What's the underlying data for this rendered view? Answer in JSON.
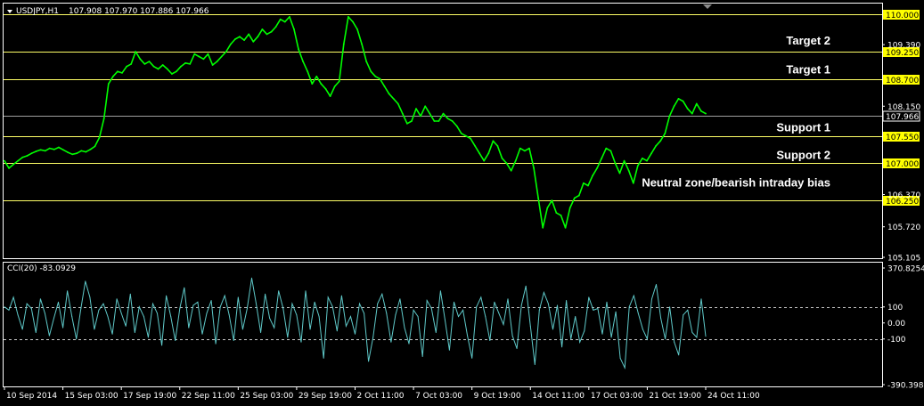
{
  "header": {
    "symbol": "USDJPY,H1",
    "quotes": "107.908 107.970 107.886 107.966",
    "indicator": "CCI(20) -83.0929"
  },
  "colors": {
    "background": "#000000",
    "frame": "#ffffff",
    "price": "#00ff00",
    "level_line": "#ffff66",
    "level_box": "#ffff00",
    "cci": "#5fc9c9"
  },
  "chart_data": [
    {
      "type": "line",
      "series": [
        {
          "values": [
            107.05,
            106.9,
            106.98,
            107.05,
            107.12,
            107.15,
            107.2,
            107.24,
            107.27,
            107.25,
            107.3,
            107.28,
            107.32,
            107.27,
            107.22,
            107.18,
            107.2,
            107.25,
            107.23,
            107.28,
            107.34,
            107.52,
            107.9,
            108.6,
            108.75,
            108.85,
            108.82,
            108.95,
            109.0,
            109.25,
            109.1,
            109.0,
            109.05,
            108.95,
            108.9,
            108.98,
            108.9,
            108.8,
            108.85,
            108.95,
            109.02,
            109.0,
            109.2,
            109.15,
            109.1,
            109.2,
            108.98,
            109.05,
            109.15,
            109.25,
            109.4,
            109.5,
            109.55,
            109.48,
            109.6,
            109.45,
            109.55,
            109.7,
            109.6,
            109.65,
            109.75,
            109.9,
            109.85,
            109.95,
            109.7,
            109.3,
            109.05,
            108.85,
            108.6,
            108.75,
            108.6,
            108.5,
            108.35,
            108.55,
            108.65,
            109.4,
            109.95,
            109.85,
            109.7,
            109.4,
            109.05,
            108.85,
            108.75,
            108.7,
            108.55,
            108.4,
            108.3,
            108.2,
            108.0,
            107.8,
            107.85,
            108.1,
            107.95,
            108.15,
            108.0,
            107.85,
            107.85,
            108.0,
            107.9,
            107.85,
            107.75,
            107.6,
            107.55,
            107.5,
            107.35,
            107.2,
            107.05,
            107.2,
            107.45,
            107.35,
            107.1,
            107.0,
            106.85,
            107.05,
            107.3,
            107.25,
            107.3,
            106.9,
            106.3,
            105.7,
            106.1,
            106.25,
            106.0,
            105.95,
            105.7,
            106.1,
            106.3,
            106.35,
            106.6,
            106.55,
            106.75,
            106.9,
            107.1,
            107.3,
            107.25,
            107.0,
            106.8,
            107.05,
            106.85,
            106.6,
            106.95,
            107.1,
            107.05,
            107.2,
            107.35,
            107.45,
            107.6,
            107.95,
            108.15,
            108.3,
            108.25,
            108.1,
            108.0,
            108.2,
            108.05,
            108.0
          ]
        }
      ],
      "y_ticks": [
        "110.000",
        "109.390",
        "109.250",
        "108.700",
        "108.150",
        "107.966",
        "107.550",
        "107.000",
        "106.370",
        "106.250",
        "105.720",
        "105.105"
      ],
      "x_ticks": [
        "10 Sep 2014",
        "15 Sep 03:00",
        "17 Sep 19:00",
        "22 Sep 11:00",
        "25 Sep 03:00",
        "29 Sep 19:00",
        "2 Oct 11:00",
        "7 Oct 03:00",
        "9 Oct 19:00",
        "14 Oct 11:00",
        "17 Oct 03:00",
        "21 Oct 19:00",
        "24 Oct 11:00"
      ],
      "levels": [
        {
          "price": 110.0,
          "label": "110.000"
        },
        {
          "price": 109.25,
          "label": "109.250"
        },
        {
          "price": 108.7,
          "label": "108.700"
        },
        {
          "price": 107.55,
          "label": "107.550"
        },
        {
          "price": 107.0,
          "label": "107.000"
        },
        {
          "price": 106.25,
          "label": "106.250"
        }
      ],
      "current": {
        "price": 107.966,
        "label": "107.966"
      },
      "ylim": [
        105.105,
        110.2
      ],
      "annotations": [
        {
          "text": "Target 2",
          "price": 109.48
        },
        {
          "text": "Target 1",
          "price": 108.9
        },
        {
          "text": "Support 1",
          "price": 107.73
        },
        {
          "text": "Support 2",
          "price": 107.18
        },
        {
          "text": "Neutral zone/bearish intraday bias",
          "price": 106.62
        }
      ]
    },
    {
      "type": "line",
      "series": [
        {
          "values": [
            100,
            80,
            160,
            50,
            -40,
            120,
            90,
            -60,
            150,
            60,
            -80,
            30,
            130,
            -30,
            200,
            40,
            -100,
            90,
            260,
            160,
            -40,
            80,
            120,
            40,
            -70,
            150,
            60,
            -20,
            180,
            -60,
            100,
            40,
            -90,
            120,
            60,
            -140,
            170,
            40,
            -110,
            90,
            220,
            -30,
            110,
            130,
            -70,
            60,
            140,
            -130,
            100,
            170,
            50,
            -110,
            160,
            -40,
            90,
            280,
            120,
            -60,
            180,
            30,
            -30,
            200,
            90,
            -90,
            120,
            50,
            -120,
            200,
            -40,
            130,
            40,
            -220,
            160,
            100,
            -50,
            170,
            -20,
            40,
            -70,
            120,
            60,
            -240,
            -90,
            120,
            180,
            60,
            -120,
            50,
            150,
            -30,
            -130,
            80,
            40,
            -210,
            140,
            90,
            -60,
            200,
            20,
            -170,
            130,
            40,
            80,
            -80,
            -220,
            100,
            160,
            40,
            -110,
            130,
            60,
            -10,
            150,
            -80,
            -160,
            110,
            230,
            -20,
            -260,
            80,
            190,
            120,
            -40,
            110,
            -150,
            140,
            -100,
            40,
            -120,
            -50,
            160,
            80,
            90,
            -70,
            130,
            -90,
            70,
            -220,
            -280,
            100,
            170,
            60,
            -40,
            -100,
            150,
            240,
            30,
            -100,
            100,
            -120,
            -200,
            50,
            80,
            -60,
            -90,
            150,
            -83
          ]
        }
      ],
      "y_ticks": [
        "370.8254",
        "100",
        "0.00",
        "-100",
        "-390.3988"
      ],
      "levels": [
        {
          "value": 100
        },
        {
          "value": -100
        }
      ],
      "ylim": [
        -390.3988,
        370.8254
      ]
    }
  ]
}
